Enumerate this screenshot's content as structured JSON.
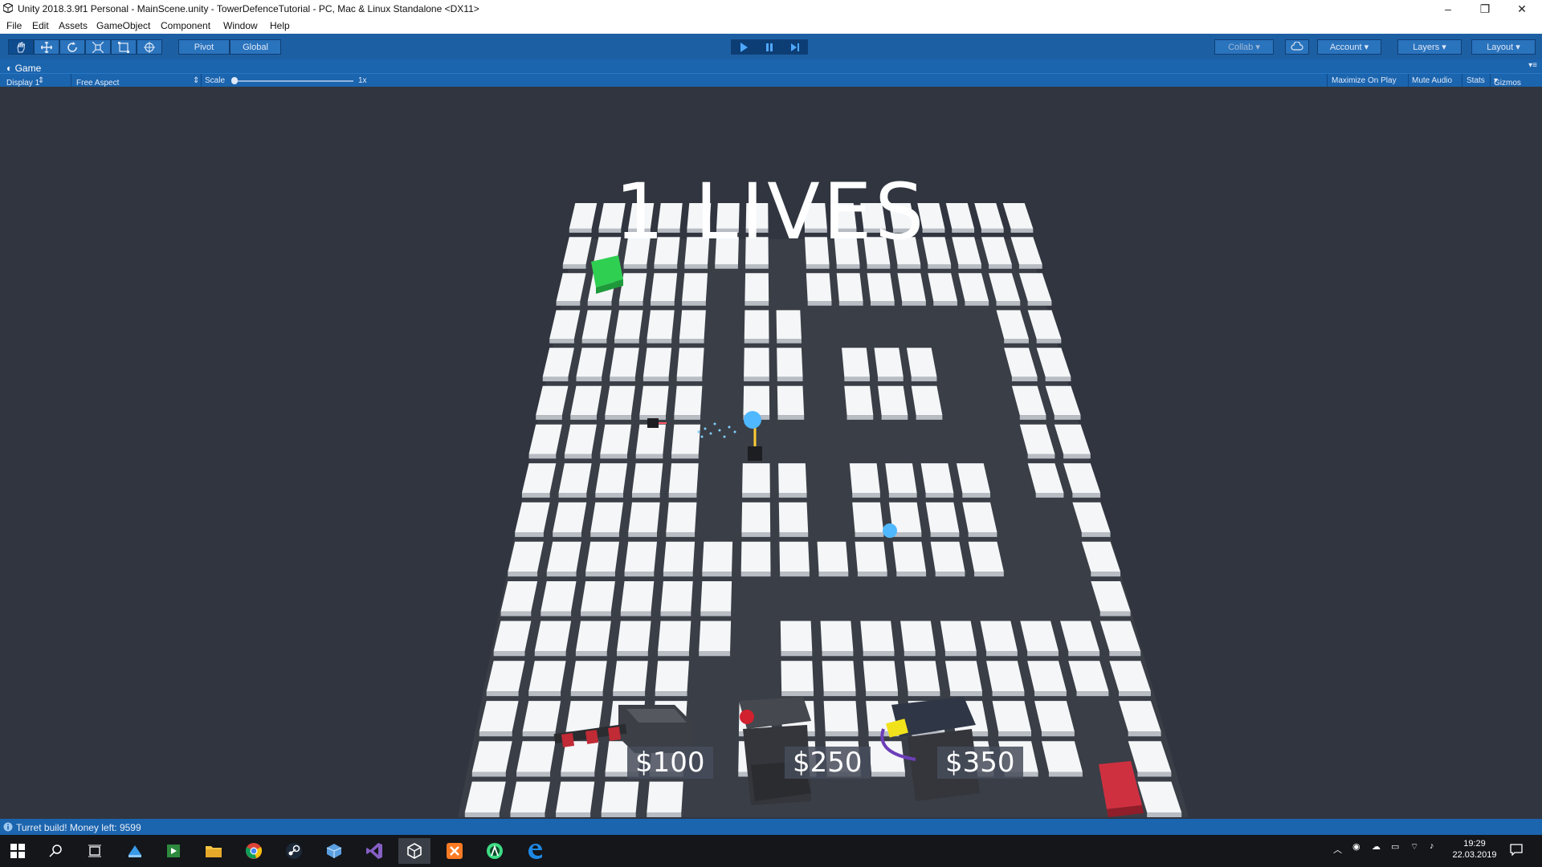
{
  "window": {
    "title": "Unity 2018.3.9f1 Personal - MainScene.unity - TowerDefenceTutorial - PC, Mac & Linux Standalone <DX11>",
    "controls": [
      "–",
      "❐",
      "✕"
    ]
  },
  "menu": [
    "File",
    "Edit",
    "Assets",
    "GameObject",
    "Component",
    "Window",
    "Help"
  ],
  "toolbar": {
    "tools": [
      "hand-tool",
      "move-tool",
      "rotate-tool",
      "scale-tool",
      "rect-tool",
      "transform-tool"
    ],
    "pivot_label": "Pivot",
    "global_label": "Global",
    "play_controls": [
      "play",
      "pause",
      "step"
    ],
    "collab_label": "Collab",
    "account_label": "Account",
    "layers_label": "Layers",
    "layout_label": "Layout"
  },
  "game_panel": {
    "tab_label": "Game",
    "display_label": "Display 1",
    "aspect_label": "Free Aspect",
    "scale_label": "Scale",
    "scale_value": "1x",
    "options": [
      "Maximize On Play",
      "Mute Audio",
      "Stats",
      "Gizmos"
    ]
  },
  "game": {
    "lives_text": "1 LIVES",
    "shop": [
      {
        "price": "$100",
        "name": "standard-turret"
      },
      {
        "price": "$250",
        "name": "missile-launcher"
      },
      {
        "price": "$350",
        "name": "laser-beamer"
      }
    ],
    "colors": {
      "start": "#33cc55",
      "end": "#cc3344",
      "tile": "#f4f6f8",
      "path": "#3b3f47"
    }
  },
  "status": {
    "message": "Turret build! Money left: 9599"
  },
  "taskbar": {
    "apps": [
      "windows-start",
      "search",
      "task-view",
      "app-1",
      "app-2",
      "file-explorer",
      "chrome",
      "steam",
      "app-3",
      "visual-studio",
      "unity",
      "xampp",
      "android-studio",
      "edge"
    ],
    "time": "19:29",
    "date": "22.03.2019"
  }
}
